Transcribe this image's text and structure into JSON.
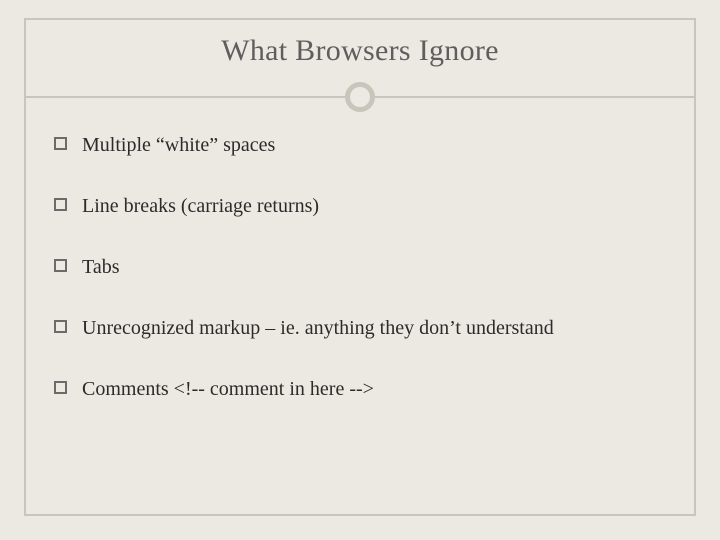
{
  "title": "What Browsers Ignore",
  "bullets": [
    "Multiple “white” spaces",
    "Line breaks (carriage returns)",
    "Tabs",
    "Unrecognized markup – ie. anything they don’t understand",
    "Comments <!--  comment in here -->"
  ]
}
